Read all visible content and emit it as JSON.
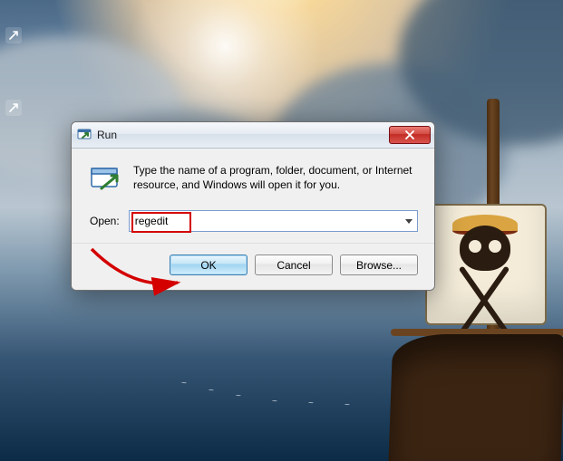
{
  "dialog": {
    "title": "Run",
    "description": "Type the name of a program, folder, document, or Internet resource, and Windows will open it for you.",
    "open_label": "Open:",
    "input_value": "regedit",
    "buttons": {
      "ok": "OK",
      "cancel": "Cancel",
      "browse": "Browse..."
    }
  },
  "annotation": {
    "highlight_target": "input_value",
    "arrow_target": "ok_button",
    "color": "#d40000"
  }
}
